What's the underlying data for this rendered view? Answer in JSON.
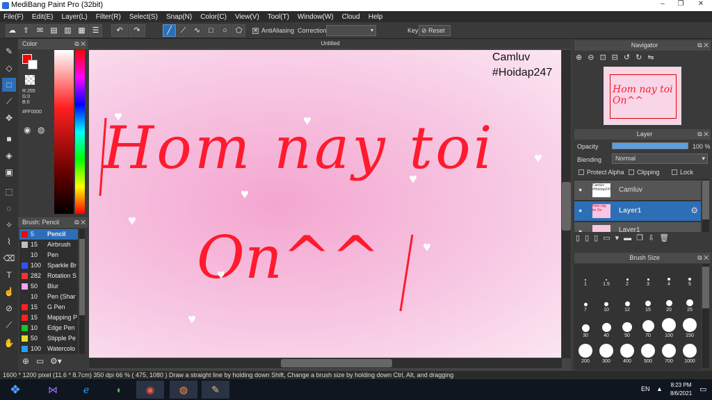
{
  "window": {
    "title": "MediBang Paint Pro (32bit)"
  },
  "menu": [
    "File(F)",
    "Edit(E)",
    "Layer(L)",
    "Filter(R)",
    "Select(S)",
    "Snap(N)",
    "Color(C)",
    "View(V)",
    "Tool(T)",
    "Window(W)",
    "Cloud",
    "Help"
  ],
  "toolbar": {
    "antialias_label": "AntiAliasing",
    "correction_label": "Correction",
    "key_label": "Key",
    "reset_label": "Reset"
  },
  "color_panel": {
    "title": "Color",
    "r": "R:255",
    "g": "G:0",
    "b": "B:0",
    "hex": "#FF0000",
    "primary": "#ff0000"
  },
  "brush_panel": {
    "title": "Brush: Pencil",
    "items": [
      {
        "size": "5",
        "name": "Pencil",
        "color": "#ff0000"
      },
      {
        "size": "15",
        "name": "Airbrush",
        "color": "#c0c0c0"
      },
      {
        "size": "10",
        "name": "Pen",
        "color": "#303030"
      },
      {
        "size": "100",
        "name": "Sparkle Br",
        "color": "#3050ff"
      },
      {
        "size": "282",
        "name": "Rotation S",
        "color": "#ff3030"
      },
      {
        "size": "50",
        "name": "Blur",
        "color": "#ffa0ff"
      },
      {
        "size": "10",
        "name": "Pen (Shar",
        "color": "#303030"
      },
      {
        "size": "15",
        "name": "G Pen",
        "color": "#ff2020"
      },
      {
        "size": "15",
        "name": "Mapping P",
        "color": "#ff2020"
      },
      {
        "size": "10",
        "name": "Edge Pen",
        "color": "#20c020"
      },
      {
        "size": "50",
        "name": "Stipple Pe",
        "color": "#e0e020"
      },
      {
        "size": "100",
        "name": "Watercolo",
        "color": "#20a0ff"
      }
    ]
  },
  "canvas": {
    "tab_title": "Untitled",
    "credit1": "Camluv",
    "credit2": "#Hoidap247",
    "line1": "Hom nay toi",
    "line2": "On^^"
  },
  "navigator": {
    "title": "Navigator"
  },
  "layer_panel": {
    "title": "Layer",
    "opacity_label": "Opacity",
    "opacity_value": "100 %",
    "blending_label": "Blending",
    "blending_value": "Normal",
    "protect_alpha": "Protect Alpha",
    "clipping": "Clipping",
    "lock": "Lock",
    "layers": [
      {
        "name": "Camluv",
        "thumb": "Camluv #Hoidap247"
      },
      {
        "name": "Layer1",
        "thumb": "Hom nay toi On"
      },
      {
        "name": "Layer1",
        "thumb": ""
      }
    ]
  },
  "brush_size_panel": {
    "title": "Brush Size",
    "sizes": [
      "1",
      "1.5",
      "2",
      "3",
      "4",
      "5",
      "7",
      "10",
      "12",
      "15",
      "20",
      "25",
      "30",
      "40",
      "50",
      "70",
      "100",
      "150",
      "200",
      "300",
      "400",
      "500",
      "700",
      "1000"
    ]
  },
  "status": {
    "text": "1600 * 1200 pixel   (11.6 * 8.7cm)   350 dpi   66 %   ( 475, 1080 )   Draw a straight line by holding down Shift, Change a brush size by holding down Ctrl, Alt, and dragging"
  },
  "taskbar": {
    "lang": "EN",
    "time": "8:23 PM",
    "date": "8/6/2021"
  }
}
